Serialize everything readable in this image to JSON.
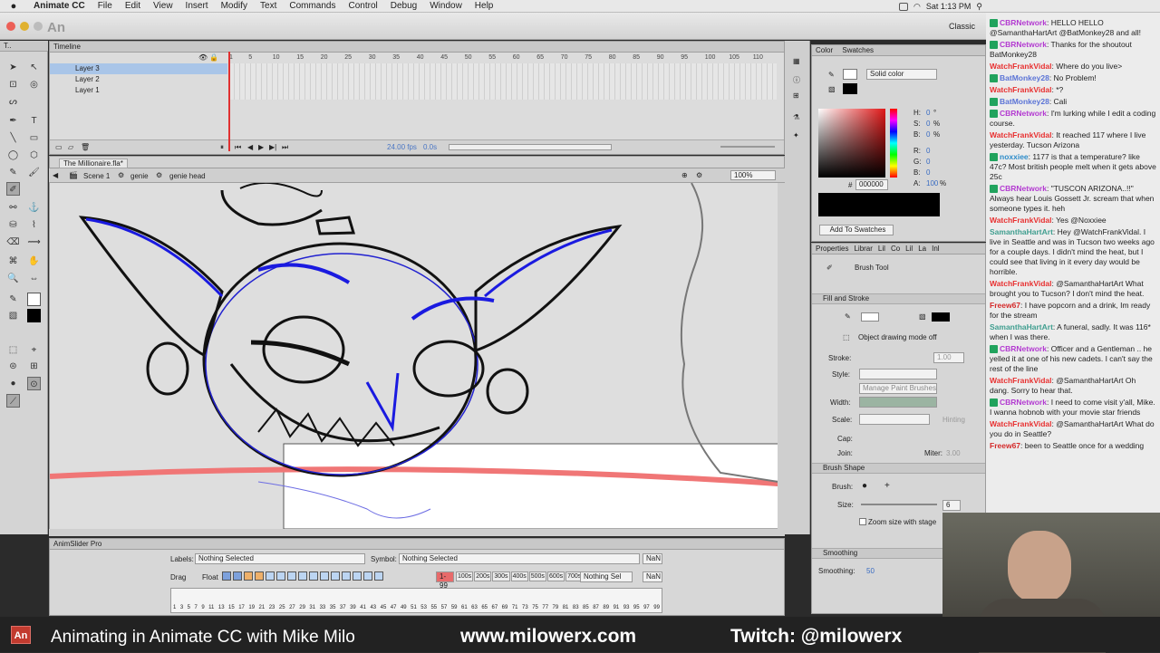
{
  "menubar": {
    "app": "Animate CC",
    "items": [
      "File",
      "Edit",
      "View",
      "Insert",
      "Modify",
      "Text",
      "Commands",
      "Control",
      "Debug",
      "Window",
      "Help"
    ],
    "clock": "Sat 1:13 PM"
  },
  "window": {
    "logo": "An",
    "workspace": "Classic"
  },
  "timeline": {
    "title": "Timeline",
    "layers": [
      "Layer 3",
      "Layer 2",
      "Layer 1"
    ],
    "ruler": [
      "1",
      "5",
      "10",
      "15",
      "20",
      "25",
      "30",
      "35",
      "40",
      "45",
      "50",
      "55",
      "60",
      "65",
      "70",
      "75",
      "80",
      "85",
      "90",
      "95",
      "100",
      "105",
      "110"
    ],
    "fps": "24.00 fps",
    "time": "0.0s"
  },
  "document": {
    "tab": "The Millionaire.fla*",
    "breadcrumb": [
      "Scene 1",
      "genie",
      "genie head"
    ],
    "zoom": "100%"
  },
  "animslider": {
    "title": "AnimSlider Pro",
    "labels_label": "Labels:",
    "labels_value": "Nothing Selected",
    "symbol_label": "Symbol:",
    "symbol_value": "Nothing Selected",
    "nan": "NaN",
    "drag": "Drag",
    "float": "Float",
    "red_value": "1-99",
    "buttons": [
      "100s",
      "200s",
      "300s",
      "400s",
      "500s",
      "600s",
      "700s"
    ],
    "nothing_sel": "Nothing Sel",
    "numbers": [
      "1",
      "3",
      "5",
      "7",
      "9",
      "11",
      "13",
      "15",
      "17",
      "19",
      "21",
      "23",
      "25",
      "27",
      "29",
      "31",
      "33",
      "35",
      "37",
      "39",
      "41",
      "43",
      "45",
      "47",
      "49",
      "51",
      "53",
      "55",
      "57",
      "59",
      "61",
      "63",
      "65",
      "67",
      "69",
      "71",
      "73",
      "75",
      "77",
      "79",
      "81",
      "83",
      "85",
      "87",
      "89",
      "91",
      "93",
      "95",
      "97",
      "99"
    ]
  },
  "color": {
    "tabs": [
      "Color",
      "Swatches"
    ],
    "mode": "Solid color",
    "h_label": "H:",
    "h": "0",
    "h_unit": "°",
    "s_label": "S:",
    "s": "0",
    "s_unit": "%",
    "b_label": "B:",
    "b": "0",
    "b_unit": "%",
    "r_label": "R:",
    "r": "0",
    "g_label": "G:",
    "g": "0",
    "bl_label": "B:",
    "bl": "0",
    "a_label": "A:",
    "a": "100",
    "a_unit": "%",
    "hex_label": "#",
    "hex": "000000",
    "add_swatches": "Add To Swatches",
    "accent": "#e01818"
  },
  "properties": {
    "tabs": [
      "Properties",
      "Librar",
      "Lil",
      "Co",
      "Lil",
      "La",
      "Inl"
    ],
    "tool": "Brush Tool",
    "fill_stroke": "Fill and Stroke",
    "object_mode": "Object drawing mode off",
    "stroke": "Stroke:",
    "stroke_val": "1.00",
    "style": "Style:",
    "manage": "Manage Paint Brushes",
    "width": "Width:",
    "scale": "Scale:",
    "hinting": "Hinting",
    "cap": "Cap:",
    "join": "Join:",
    "miter": "Miter:",
    "miter_val": "3.00",
    "brush_shape": "Brush Shape",
    "brush": "Brush:",
    "size": "Size:",
    "size_val": "6",
    "zoom_size": "Zoom size with stage",
    "smoothing_hdr": "Smoothing",
    "smoothing": "Smoothing:",
    "smoothing_val": "50"
  },
  "chat": [
    {
      "user": "CBRNetwork",
      "color": "#b33ad1",
      "badge": true,
      "text": "HELLO HELLO @SamanthaHartArt @BatMonkey28 and all!"
    },
    {
      "user": "CBRNetwork",
      "color": "#b33ad1",
      "badge": true,
      "text": "Thanks for the shoutout BatMonkey28"
    },
    {
      "user": "WatchFrankVidal",
      "color": "#e83030",
      "badge": false,
      "text": "Where do you live>"
    },
    {
      "user": "BatMonkey28",
      "color": "#5b74d6",
      "badge": true,
      "text": "No Problem!"
    },
    {
      "user": "WatchFrankVidal",
      "color": "#e83030",
      "badge": false,
      "text": "*?"
    },
    {
      "user": "BatMonkey28",
      "color": "#5b74d6",
      "badge": true,
      "text": "Cali"
    },
    {
      "user": "CBRNetwork",
      "color": "#b33ad1",
      "badge": true,
      "text": "I'm lurking while I edit a coding course."
    },
    {
      "user": "WatchFrankVidal",
      "color": "#e83030",
      "badge": false,
      "text": "It reached 117 where I live yesterday. Tucson Arizona"
    },
    {
      "user": "noxxiee",
      "color": "#2c8bc9",
      "badge": true,
      "text": "1177 is that a temperature? like 47c? Most british people melt when it gets above 25c"
    },
    {
      "user": "CBRNetwork",
      "color": "#b33ad1",
      "badge": true,
      "text": "\"TUSCON ARIZONA..!!\" Always hear Louis Gossett Jr. scream that when someone types it. heh"
    },
    {
      "user": "WatchFrankVidal",
      "color": "#e83030",
      "badge": false,
      "text": "Yes @Noxxiee"
    },
    {
      "user": "SamanthaHartArt",
      "color": "#3f9e8f",
      "badge": false,
      "text": "Hey @WatchFrankVidal. I live in Seattle and was in Tucson two weeks ago for a couple days. I didn't mind the heat, but I could see that living in it every day would be horrible."
    },
    {
      "user": "WatchFrankVidal",
      "color": "#e83030",
      "badge": false,
      "text": "@SamanthaHartArt What brought you to Tucson? I don't mind the heat."
    },
    {
      "user": "Freew67",
      "color": "#d42a2a",
      "badge": false,
      "text": "I have popcorn and a drink, Im ready for the stream"
    },
    {
      "user": "SamanthaHartArt",
      "color": "#3f9e8f",
      "badge": false,
      "text": "A funeral, sadly. It was 116* when I was there."
    },
    {
      "user": "CBRNetwork",
      "color": "#b33ad1",
      "badge": true,
      "text": "Officer and a Gentleman .. he yelled it at one of his new cadets. I can't say the rest of the line"
    },
    {
      "user": "WatchFrankVidal",
      "color": "#e83030",
      "badge": false,
      "text": "@SamanthaHartArt Oh dang. Sorry to hear that."
    },
    {
      "user": "CBRNetwork",
      "color": "#b33ad1",
      "badge": true,
      "text": "I need to come visit y'all, Mike. I wanna hobnob with your movie star friends"
    },
    {
      "user": "WatchFrankVidal",
      "color": "#e83030",
      "badge": false,
      "text": "@SamanthaHartArt What do you do in Seattle?"
    },
    {
      "user": "Freew67",
      "color": "#d42a2a",
      "badge": false,
      "text": "been to Seattle once for a wedding"
    }
  ],
  "lower_third": {
    "title": "Animating in Animate CC with Mike Milo",
    "site": "www.milowerx.com",
    "twitch": "Twitch: @milowerx"
  }
}
